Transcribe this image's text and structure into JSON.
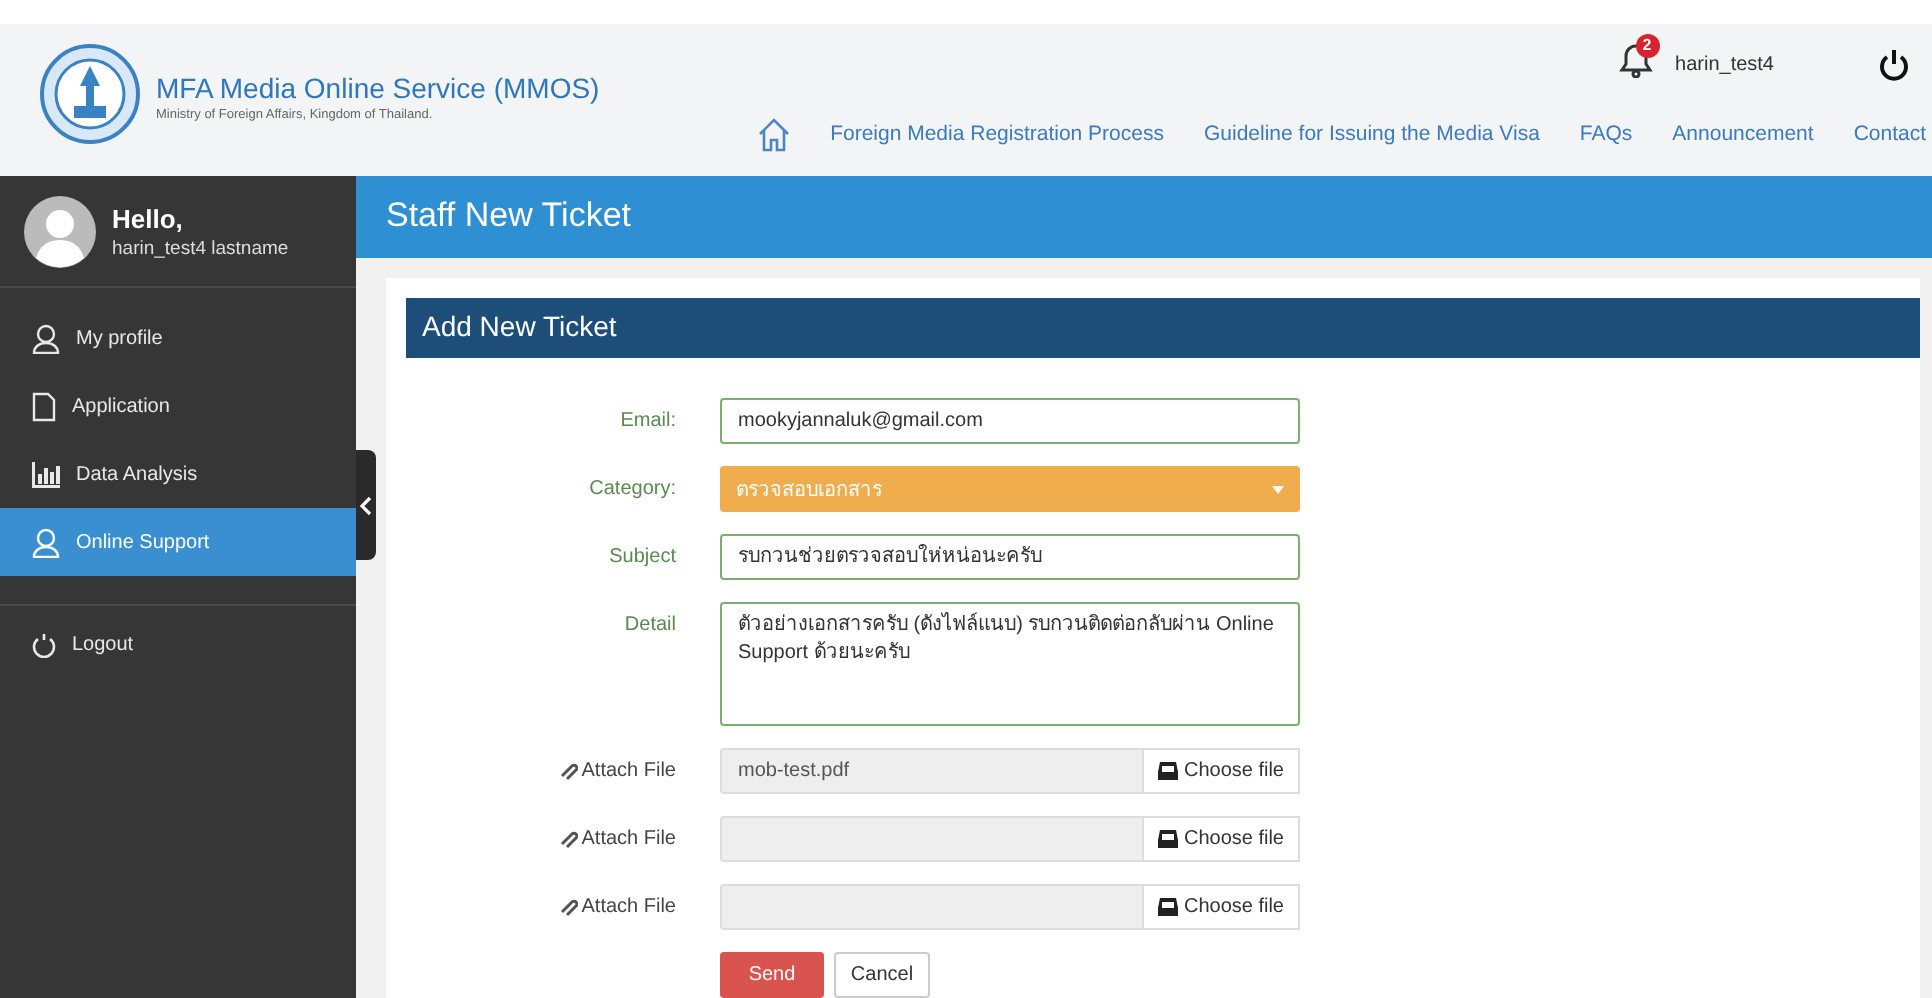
{
  "header": {
    "title": "MFA Media Online Service (MMOS)",
    "subtitle": "Ministry of Foreign Affairs, Kingdom of Thailand.",
    "notifications": "2",
    "user": "harin_test4",
    "nav": [
      "Foreign Media Registration Process",
      "Guideline for Issuing the Media Visa",
      "FAQs",
      "Announcement",
      "Contact"
    ]
  },
  "sidebar": {
    "greeting": "Hello,",
    "user": "harin_test4 lastname",
    "items": [
      {
        "kind": "person",
        "label": "My profile",
        "selected": false
      },
      {
        "kind": "document",
        "label": "Application",
        "selected": false
      },
      {
        "kind": "chart",
        "label": "Data Analysis",
        "selected": false
      },
      {
        "kind": "person",
        "label": "Online Support",
        "selected": true
      }
    ],
    "logout": "Logout"
  },
  "page_title": "Staff New Ticket",
  "form": {
    "title": "Add New Ticket",
    "fields": [
      {
        "kind": "input",
        "label": "Email:",
        "value": "mookyjannaluk@gmail.com"
      },
      {
        "kind": "select",
        "label": "Category:",
        "value": "ตรวจสอบเอกสาร"
      },
      {
        "kind": "input",
        "label": "Subject",
        "value": "รบกวนช่วยตรวจสอบให่หน่อนะครับ"
      },
      {
        "kind": "textarea",
        "label": "Detail",
        "value": "ตัวอย่างเอกสารครับ (ดังไฟล์แนบ) รบกวนติดต่อกลับผ่าน Online Support ด้วยนะครับ"
      }
    ],
    "attachments": [
      {
        "label": "Attach File",
        "value": "mob-test.pdf",
        "button": "Choose file"
      },
      {
        "label": "Attach File",
        "button": "Choose file"
      },
      {
        "label": "Attach File",
        "button": "Choose file"
      }
    ],
    "send": "Send",
    "cancel": "Cancel"
  }
}
